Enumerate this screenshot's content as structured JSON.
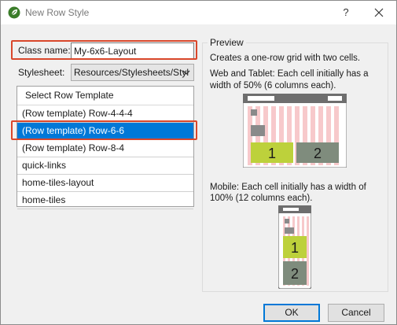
{
  "window": {
    "title": "New Row Style",
    "help_label": "?",
    "close_label": "✕"
  },
  "form": {
    "class_name_label": "Class name:",
    "class_name_value": "My-6x6-Layout",
    "stylesheet_label": "Stylesheet:",
    "stylesheet_value": "Resources/Stylesheets/Styl"
  },
  "templates": {
    "header": "Select Row Template",
    "items": [
      {
        "label": "(Row template) Row-4-4-4",
        "selected": false
      },
      {
        "label": "(Row template) Row-6-6",
        "selected": true
      },
      {
        "label": "(Row template) Row-8-4",
        "selected": false
      },
      {
        "label": "quick-links",
        "selected": false
      },
      {
        "label": "home-tiles-layout",
        "selected": false
      },
      {
        "label": "home-tiles",
        "selected": false
      }
    ]
  },
  "preview": {
    "title": "Preview",
    "summary": "Creates a one-row grid with two cells.",
    "web_line1": "Web and Tablet: Each cell initially has a",
    "web_line2": "width of 50% (6 columns each).",
    "mobile_line1": "Mobile: Each cell initially has a width of",
    "mobile_line2": "100% (12 columns each).",
    "cell1": "1",
    "cell2": "2"
  },
  "buttons": {
    "ok": "OK",
    "cancel": "Cancel"
  },
  "colors": {
    "highlight": "#d9472b",
    "selection": "#0078d7",
    "cell_green": "#bdd13b",
    "cell_gray": "#7f8c7d",
    "stripe_pink": "#f7c9cb"
  }
}
